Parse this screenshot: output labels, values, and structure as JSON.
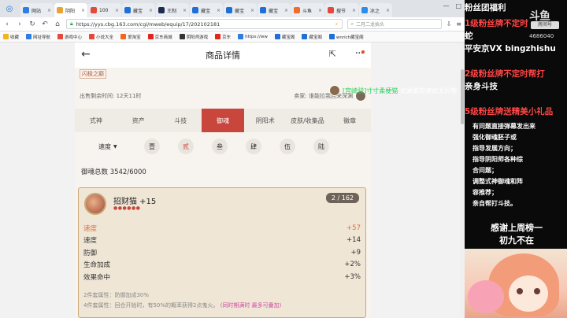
{
  "browser": {
    "tabs": [
      {
        "label": "网站",
        "color": "#2f7de1",
        "active": false
      },
      {
        "label": "阴阳",
        "color": "#e9a234",
        "active": true
      },
      {
        "label": "100",
        "color": "#e24a3b",
        "active": false
      },
      {
        "label": "藏宝",
        "color": "#1f6fd6",
        "active": false
      },
      {
        "label": "王制",
        "color": "#1d2b4f",
        "active": false
      },
      {
        "label": "藏宝",
        "color": "#1f6fd6",
        "active": false
      },
      {
        "label": "藏宝",
        "color": "#1f6fd6",
        "active": false
      },
      {
        "label": "藏宝",
        "color": "#1f6fd6",
        "active": false
      },
      {
        "label": "斗鱼",
        "color": "#f06c2d",
        "active": false
      },
      {
        "label": "搜节",
        "color": "#e24a3b",
        "active": false
      },
      {
        "label": "冰之",
        "color": "#2b8fe8",
        "active": false
      }
    ],
    "url": "https://yys.cbg.163.com/cgi/mweb/equip/17/202102181",
    "search_placeholder": "二月二龙抬头",
    "bookmarks": [
      {
        "label": "收藏",
        "color": "#f2b51b"
      },
      {
        "label": "网址导航",
        "color": "#2f7de1"
      },
      {
        "label": "游戏中心",
        "color": "#e24a3b"
      },
      {
        "label": "小说大全",
        "color": "#e24a3b"
      },
      {
        "label": "爱淘宝",
        "color": "#f5641b"
      },
      {
        "label": "京东商城",
        "color": "#e1251b"
      },
      {
        "label": "阴阳师游戏",
        "color": "#333333"
      },
      {
        "label": "京东",
        "color": "#e1251b"
      },
      {
        "label": "https://ww",
        "color": "#2f7de1"
      },
      {
        "label": "藏宝阁",
        "color": "#1f6fd6"
      },
      {
        "label": "藏宝阁",
        "color": "#1f6fd6"
      },
      {
        "label": "wnrich藏宝阁",
        "color": "#1f6fd6"
      }
    ]
  },
  "page": {
    "title": "商品详情",
    "tag": "闪极之巅",
    "remaining_time": "出售剩余时间: 12天11时",
    "seller": "卖家: 谁能拉我回来深渊",
    "tabs": [
      "式神",
      "资产",
      "斗技",
      "御魂",
      "阴阳术",
      "皮肤/收集品",
      "徽章"
    ],
    "active_tab_index": 3,
    "sort_label": "速度",
    "positions": [
      "壹",
      "贰",
      "叁",
      "肆",
      "伍",
      "陆"
    ],
    "active_position_index": 1,
    "total_label": "御魂总数 3542/6000",
    "soul": {
      "name": "招财猫 +15",
      "level": "●●●●●●",
      "count": "2 / 162",
      "stats": [
        {
          "k": "速度",
          "v": "+57"
        },
        {
          "k": "速度",
          "v": "+14"
        },
        {
          "k": "防御",
          "v": "+9"
        },
        {
          "k": "生命加成",
          "v": "+2%"
        },
        {
          "k": "效果命中",
          "v": "+3%"
        }
      ],
      "set2": "2件套属性：防御加成30%",
      "set4": "4件套属性：回合开始时，有50%的概率获得2点鬼火。",
      "set4_tail": "(同时期满时 最多可叠加)"
    },
    "overlay_chat": {
      "name": "[宫崎骏]寸寸柔梗猫",
      "text": "如果能提速就太厉害"
    }
  },
  "stream": {
    "lines": [
      {
        "text": "粉丝团福利",
        "color": "#ffffff"
      },
      {
        "text": "1级粉丝牌不定时",
        "color": "#ff4747"
      },
      {
        "text": "蛇",
        "color": "#ffffff"
      },
      {
        "text": "平安京VX  bingzhishu",
        "color": "#ffffff"
      },
      {
        "text": "2级粉丝牌不定时帮打",
        "color": "#ff4747"
      },
      {
        "text": "亲身斗技",
        "color": "#ffffff"
      },
      {
        "text": "5级粉丝牌送精美小礼品",
        "color": "#ff4747"
      }
    ],
    "logo_text": "斗鱼",
    "logo_badge": "房间号",
    "room_id": "4686040",
    "notice": [
      "有问题直接弹幕发出来",
      "强化御魂胚子或",
      "指导发展方向；",
      "指导阴阳师各种综",
      "合问题；",
      "调整式神御魂和阵",
      "容推荐；",
      "亲自帮打斗技。"
    ],
    "thanks_line1": "感谢上周榜一",
    "thanks_line2": "初九不在"
  }
}
